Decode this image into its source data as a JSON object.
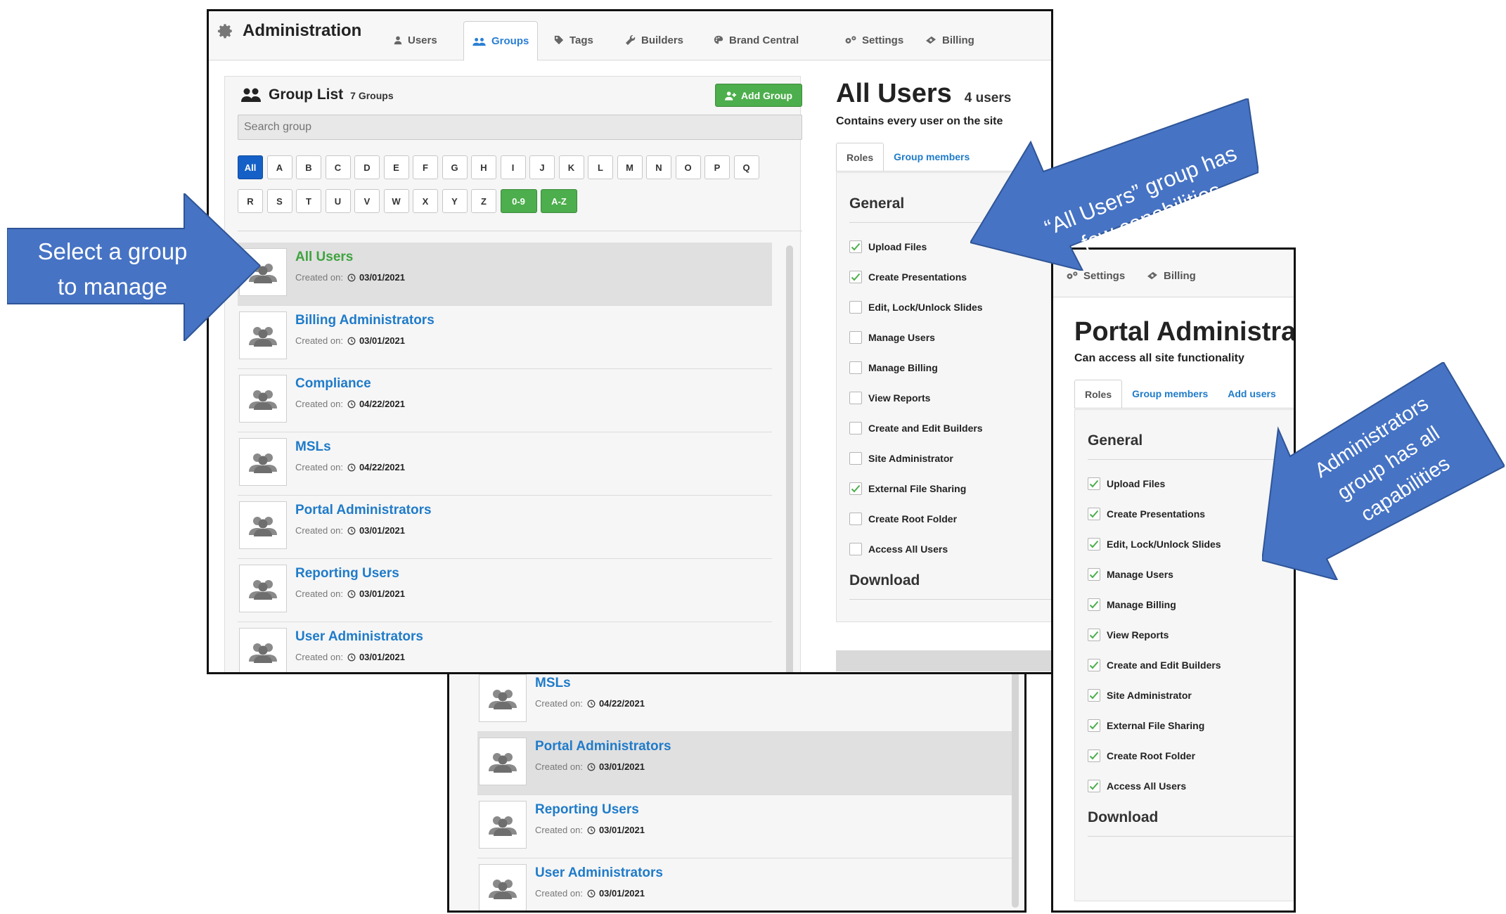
{
  "admin": {
    "title": "Administration",
    "tabs": [
      {
        "label": "Users",
        "icon": "user-icon"
      },
      {
        "label": "Groups",
        "icon": "groups-icon",
        "active": true
      },
      {
        "label": "Tags",
        "icon": "tag-icon"
      },
      {
        "label": "Builders",
        "icon": "wrench-icon"
      },
      {
        "label": "Brand Central",
        "icon": "palette-icon"
      },
      {
        "label": "Settings",
        "icon": "gears-icon"
      },
      {
        "label": "Billing",
        "icon": "money-icon"
      }
    ]
  },
  "group_list": {
    "title": "Group List",
    "count": "7 Groups",
    "add_button": "Add Group",
    "search_placeholder": "Search group",
    "letters_row1": [
      "All",
      "A",
      "B",
      "C",
      "D",
      "E",
      "F",
      "G",
      "H",
      "I",
      "J",
      "K",
      "L",
      "M",
      "N",
      "O",
      "P",
      "Q"
    ],
    "letters_row2": [
      "R",
      "S",
      "T",
      "U",
      "V",
      "W",
      "X",
      "Y",
      "Z",
      "0-9",
      "A-Z"
    ],
    "created_label": "Created on:",
    "groups": [
      {
        "name": "All Users",
        "date": "03/01/2021"
      },
      {
        "name": "Billing Administrators",
        "date": "03/01/2021"
      },
      {
        "name": "Compliance",
        "date": "04/22/2021"
      },
      {
        "name": "MSLs",
        "date": "04/22/2021"
      },
      {
        "name": "Portal Administrators",
        "date": "03/01/2021"
      },
      {
        "name": "Reporting Users",
        "date": "03/01/2021"
      },
      {
        "name": "User Administrators",
        "date": "03/01/2021"
      }
    ]
  },
  "all_users": {
    "title": "All Users",
    "count": "4 users",
    "subtitle": "Contains every user on the site",
    "tabs": [
      "Roles",
      "Group members"
    ],
    "section_general": "General",
    "section_download": "Download"
  },
  "capabilities": [
    "Upload Files",
    "Create Presentations",
    "Edit, Lock/Unlock Slides",
    "Manage Users",
    "Manage Billing",
    "View Reports",
    "Create and Edit Builders",
    "Site Administrator",
    "External File Sharing",
    "Create Root Folder",
    "Access All Users"
  ],
  "all_users_checked": [
    true,
    true,
    false,
    false,
    false,
    false,
    false,
    false,
    true,
    false,
    false
  ],
  "portal": {
    "tabs_top": [
      "Settings",
      "Billing"
    ],
    "title": "Portal Administrators",
    "subtitle": "Can access all site functionality",
    "tabs": [
      "Roles",
      "Group members",
      "Add users"
    ],
    "section_general": "General",
    "section_download": "Download"
  },
  "callouts": {
    "select_line1": "Select a group",
    "select_line2": "to manage",
    "all_users_line1": "“All Users” group has",
    "all_users_line2": "few capabilities",
    "admin_line1": "Administrators",
    "admin_line2": "group has all",
    "admin_line3": "capabilities"
  },
  "colors": {
    "link_blue": "#1f7bc9",
    "selected_green": "#3fa33f",
    "button_green": "#4cae4c",
    "letter_selected": "#1560c7",
    "callout_blue": "#4673c4"
  }
}
